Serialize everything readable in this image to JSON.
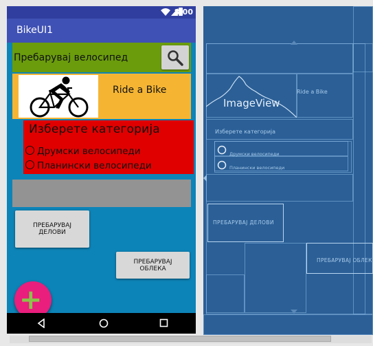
{
  "status_bar": {
    "time": "8:00"
  },
  "app_bar": {
    "title": "BikeUI1"
  },
  "search": {
    "label": "Пребарувај велосипед",
    "icon": "search-icon"
  },
  "hero": {
    "label": "Ride a Bike",
    "image": "cyclist-silhouette"
  },
  "category": {
    "title": "Изберете категорија",
    "options": [
      "Друмски велосипеди",
      "Планински велосипеди"
    ]
  },
  "buttons": {
    "parts": "ПРЕБАРУВАЈ ДЕЛОВИ",
    "clothes": "ПРЕБАРУВАЈ ОБЛЕКА"
  },
  "fab": {
    "icon": "plus-icon",
    "symbol": "+"
  },
  "blueprint": {
    "imageview": "ImageView",
    "ride": "Ride a Bike",
    "category": "Изберете категорија",
    "road": "Друмски велосипеди",
    "mountain": "Планински велосипеди",
    "parts": "ПРЕБАРУВАЈ ДЕЛОВИ",
    "clothes": "ПРЕБАРУВАЈ ОБЛЕКА"
  },
  "colors": {
    "primary": "#3f51b5",
    "primary_dark": "#303f9f",
    "accent": "#e91e7d",
    "background": "#19a0d8",
    "search_row": "#6a9c0c",
    "hero_row": "#f5b533",
    "category_panel": "#e00000",
    "blueprint": "#2b5f96"
  }
}
